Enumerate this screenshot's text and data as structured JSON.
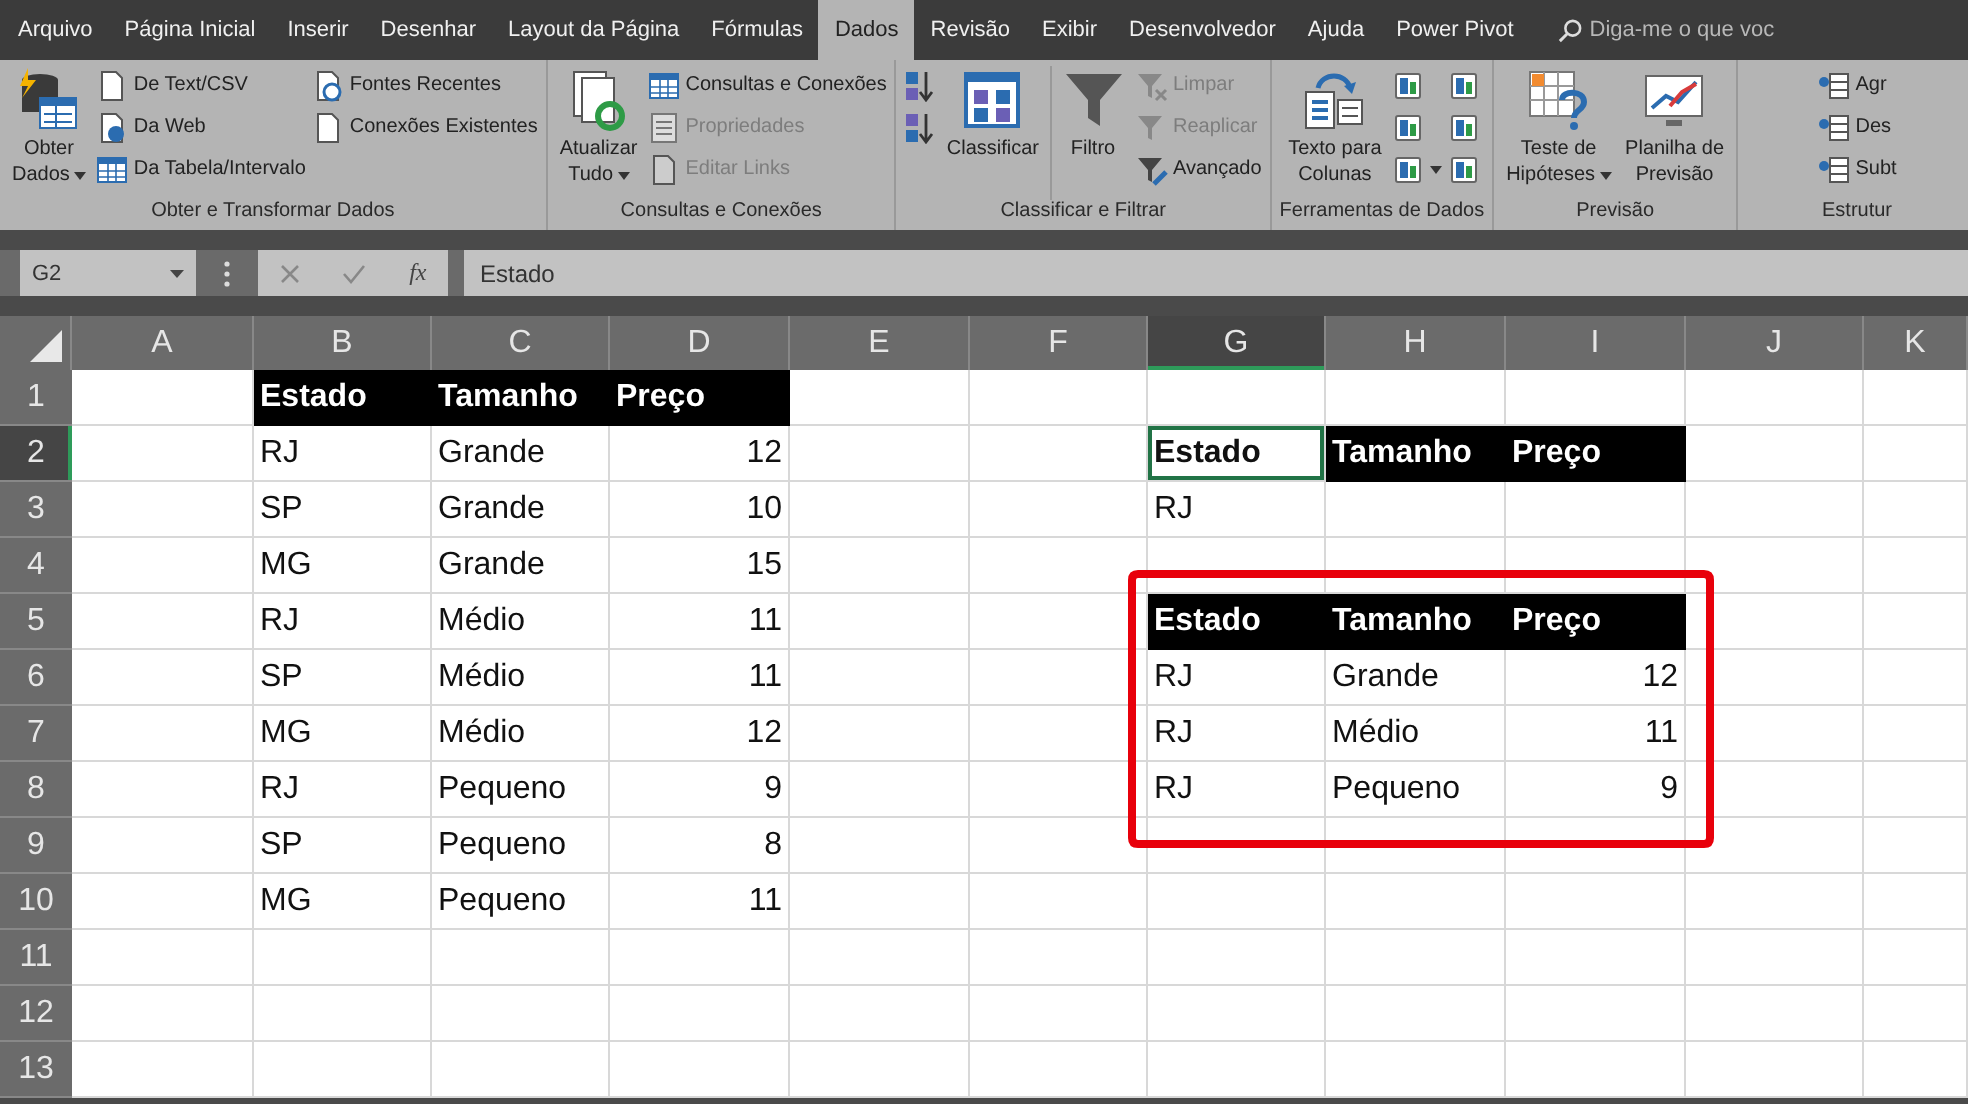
{
  "tabs": [
    {
      "label": "Arquivo",
      "selected": false
    },
    {
      "label": "Página Inicial",
      "selected": false
    },
    {
      "label": "Inserir",
      "selected": false
    },
    {
      "label": "Desenhar",
      "selected": false
    },
    {
      "label": "Layout da Página",
      "selected": false
    },
    {
      "label": "Fórmulas",
      "selected": false
    },
    {
      "label": "Dados",
      "selected": true
    },
    {
      "label": "Revisão",
      "selected": false
    },
    {
      "label": "Exibir",
      "selected": false
    },
    {
      "label": "Desenvolvedor",
      "selected": false
    },
    {
      "label": "Ajuda",
      "selected": false
    },
    {
      "label": "Power Pivot",
      "selected": false
    }
  ],
  "search": {
    "placeholder": "Diga-me o que voc"
  },
  "ribbon_groups": [
    {
      "label": "Obter e Transformar Dados",
      "items": [
        {
          "kind": "large",
          "lines": [
            "Obter",
            "Dados"
          ],
          "dropdown": true,
          "disabled": false
        },
        {
          "kind": "stack",
          "commands": [
            {
              "label": "De Text/CSV",
              "disabled": false,
              "dropdown": false
            },
            {
              "label": "Da Web",
              "disabled": false,
              "dropdown": false
            },
            {
              "label": "Da Tabela/Intervalo",
              "disabled": false,
              "dropdown": false
            }
          ]
        },
        {
          "kind": "stack",
          "commands": [
            {
              "label": "Fontes Recentes",
              "disabled": false,
              "dropdown": false
            },
            {
              "label": "Conexões Existentes",
              "disabled": false,
              "dropdown": false
            }
          ]
        }
      ]
    },
    {
      "label": "Consultas e Conexões",
      "items": [
        {
          "kind": "large",
          "lines": [
            "Atualizar",
            "Tudo"
          ],
          "dropdown": true,
          "disabled": false
        },
        {
          "kind": "stack",
          "commands": [
            {
              "label": "Consultas e Conexões",
              "disabled": false,
              "dropdown": false
            },
            {
              "label": "Propriedades",
              "disabled": true,
              "dropdown": false
            },
            {
              "label": "Editar Links",
              "disabled": true,
              "dropdown": false
            }
          ]
        }
      ]
    },
    {
      "label": "Classificar e Filtrar",
      "items": [
        {
          "kind": "stack",
          "commands": [
            {
              "dropdown": false
            },
            {
              "dropdown": false
            }
          ]
        },
        {
          "kind": "large",
          "lines": [
            "Classificar"
          ],
          "dropdown": false,
          "disabled": false
        },
        {
          "kind": "large",
          "lines": [
            "Filtro"
          ],
          "dropdown": false,
          "disabled": false
        },
        {
          "kind": "stack",
          "commands": [
            {
              "label": "Limpar",
              "disabled": true,
              "dropdown": false
            },
            {
              "label": "Reaplicar",
              "disabled": true,
              "dropdown": false
            },
            {
              "label": "Avançado",
              "disabled": false,
              "dropdown": false
            }
          ]
        }
      ]
    },
    {
      "label": "Ferramentas de Dados",
      "items": [
        {
          "kind": "large",
          "lines": [
            "Texto para",
            "Colunas"
          ],
          "dropdown": false,
          "disabled": false
        },
        {
          "kind": "stack",
          "commands": [
            {
              "dropdown": false
            },
            {
              "dropdown": false
            },
            {
              "dropdown": true
            }
          ]
        },
        {
          "kind": "stack",
          "commands": [
            {
              "dropdown": false
            },
            {
              "dropdown": false
            },
            {
              "dropdown": false
            }
          ]
        }
      ]
    },
    {
      "label": "Previsão",
      "items": [
        {
          "kind": "large",
          "lines": [
            "Teste de",
            "Hipóteses"
          ],
          "dropdown": true,
          "disabled": false
        },
        {
          "kind": "large",
          "lines": [
            "Planilha de",
            "Previsão"
          ],
          "dropdown": false,
          "disabled": false
        }
      ]
    },
    {
      "label": "Estrutur",
      "items": [
        {
          "kind": "stack",
          "commands": [
            {
              "label": "Agr",
              "disabled": false,
              "dropdown": false
            },
            {
              "label": "Des",
              "disabled": false,
              "dropdown": false
            },
            {
              "label": "Subt",
              "disabled": false,
              "dropdown": false
            }
          ]
        }
      ]
    }
  ],
  "formula_bar": {
    "name_box": "G2",
    "insert_function": "fx",
    "formula": "Estado"
  },
  "sheet": {
    "columns": [
      {
        "label": "A",
        "selected": false
      },
      {
        "label": "B",
        "selected": false
      },
      {
        "label": "C",
        "selected": false
      },
      {
        "label": "D",
        "selected": false
      },
      {
        "label": "E",
        "selected": false
      },
      {
        "label": "F",
        "selected": false
      },
      {
        "label": "G",
        "selected": true
      },
      {
        "label": "H",
        "selected": false
      },
      {
        "label": "I",
        "selected": false
      },
      {
        "label": "J",
        "selected": false
      },
      {
        "label": "K",
        "selected": false
      }
    ],
    "rows": [
      {
        "label": "1",
        "selected": false,
        "cells": [
          null,
          {
            "text": "Estado",
            "kind": "header",
            "selected": false
          },
          {
            "text": "Tamanho",
            "kind": "header",
            "selected": false
          },
          {
            "text": "Preço",
            "kind": "header",
            "selected": false
          }
        ]
      },
      {
        "label": "2",
        "selected": true,
        "cells": [
          null,
          {
            "text": "RJ",
            "kind": "text",
            "selected": false
          },
          {
            "text": "Grande",
            "kind": "text",
            "selected": false
          },
          {
            "text": "12",
            "kind": "number",
            "selected": false
          },
          null,
          null,
          {
            "text": "Estado",
            "kind": "bold",
            "selected": true
          },
          {
            "text": "Tamanho",
            "kind": "header",
            "selected": false
          },
          {
            "text": "Preço",
            "kind": "header",
            "selected": false
          }
        ]
      },
      {
        "label": "3",
        "selected": false,
        "cells": [
          null,
          {
            "text": "SP",
            "kind": "text",
            "selected": false
          },
          {
            "text": "Grande",
            "kind": "text",
            "selected": false
          },
          {
            "text": "10",
            "kind": "number",
            "selected": false
          },
          null,
          null,
          {
            "text": "RJ",
            "kind": "text",
            "selected": false
          }
        ]
      },
      {
        "label": "4",
        "selected": false,
        "cells": [
          null,
          {
            "text": "MG",
            "kind": "text",
            "selected": false
          },
          {
            "text": "Grande",
            "kind": "text",
            "selected": false
          },
          {
            "text": "15",
            "kind": "number",
            "selected": false
          }
        ]
      },
      {
        "label": "5",
        "selected": false,
        "cells": [
          null,
          {
            "text": "RJ",
            "kind": "text",
            "selected": false
          },
          {
            "text": "Médio",
            "kind": "text",
            "selected": false
          },
          {
            "text": "11",
            "kind": "number",
            "selected": false
          },
          null,
          null,
          {
            "text": "Estado",
            "kind": "header",
            "selected": false
          },
          {
            "text": "Tamanho",
            "kind": "header",
            "selected": false
          },
          {
            "text": "Preço",
            "kind": "header",
            "selected": false
          }
        ]
      },
      {
        "label": "6",
        "selected": false,
        "cells": [
          null,
          {
            "text": "SP",
            "kind": "text",
            "selected": false
          },
          {
            "text": "Médio",
            "kind": "text",
            "selected": false
          },
          {
            "text": "11",
            "kind": "number",
            "selected": false
          },
          null,
          null,
          {
            "text": "RJ",
            "kind": "text",
            "selected": false
          },
          {
            "text": "Grande",
            "kind": "text",
            "selected": false
          },
          {
            "text": "12",
            "kind": "number",
            "selected": false
          }
        ]
      },
      {
        "label": "7",
        "selected": false,
        "cells": [
          null,
          {
            "text": "MG",
            "kind": "text",
            "selected": false
          },
          {
            "text": "Médio",
            "kind": "text",
            "selected": false
          },
          {
            "text": "12",
            "kind": "number",
            "selected": false
          },
          null,
          null,
          {
            "text": "RJ",
            "kind": "text",
            "selected": false
          },
          {
            "text": "Médio",
            "kind": "text",
            "selected": false
          },
          {
            "text": "11",
            "kind": "number",
            "selected": false
          }
        ]
      },
      {
        "label": "8",
        "selected": false,
        "cells": [
          null,
          {
            "text": "RJ",
            "kind": "text",
            "selected": false
          },
          {
            "text": "Pequeno",
            "kind": "text",
            "selected": false
          },
          {
            "text": "9",
            "kind": "number",
            "selected": false
          },
          null,
          null,
          {
            "text": "RJ",
            "kind": "text",
            "selected": false
          },
          {
            "text": "Pequeno",
            "kind": "text",
            "selected": false
          },
          {
            "text": "9",
            "kind": "number",
            "selected": false
          }
        ]
      },
      {
        "label": "9",
        "selected": false,
        "cells": [
          null,
          {
            "text": "SP",
            "kind": "text",
            "selected": false
          },
          {
            "text": "Pequeno",
            "kind": "text",
            "selected": false
          },
          {
            "text": "8",
            "kind": "number",
            "selected": false
          }
        ]
      },
      {
        "label": "10",
        "selected": false,
        "cells": [
          null,
          {
            "text": "MG",
            "kind": "text",
            "selected": false
          },
          {
            "text": "Pequeno",
            "kind": "text",
            "selected": false
          },
          {
            "text": "11",
            "kind": "number",
            "selected": false
          }
        ]
      },
      {
        "label": "11",
        "selected": false,
        "cells": []
      },
      {
        "label": "12",
        "selected": false,
        "cells": []
      },
      {
        "label": "13",
        "selected": false,
        "cells": []
      }
    ],
    "frame": {
      "color": "#e8000b"
    }
  }
}
